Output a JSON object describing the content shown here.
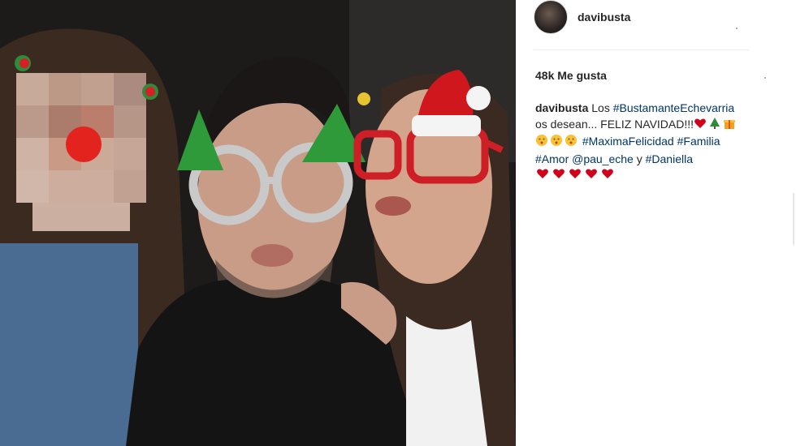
{
  "post": {
    "username": "davibusta",
    "likes_label": "48k Me gusta",
    "caption": {
      "username": "davibusta",
      "text_1": "Los",
      "tag_1": "#BustamanteEchevarria",
      "text_2": "os desean... FELIZ NAVIDAD!!!",
      "tag_2": "#MaximaFelicidad",
      "tag_3": "#Familia",
      "tag_4": "#Amor",
      "mention": "@pau_eche",
      "text_3": "y",
      "tag_5": "#Daniella"
    },
    "emojis_line1": [
      "heart-icon",
      "christmas-tree-icon",
      "gift-icon"
    ],
    "emojis_line2": [
      "kiss-face-icon",
      "kiss-face-icon",
      "kiss-face-icon"
    ],
    "emojis_line3": [
      "heart-icon",
      "heart-icon",
      "heart-icon",
      "heart-icon",
      "heart-icon"
    ]
  },
  "colors": {
    "link": "#003569",
    "text": "#262626",
    "heart": "#d0021b"
  }
}
